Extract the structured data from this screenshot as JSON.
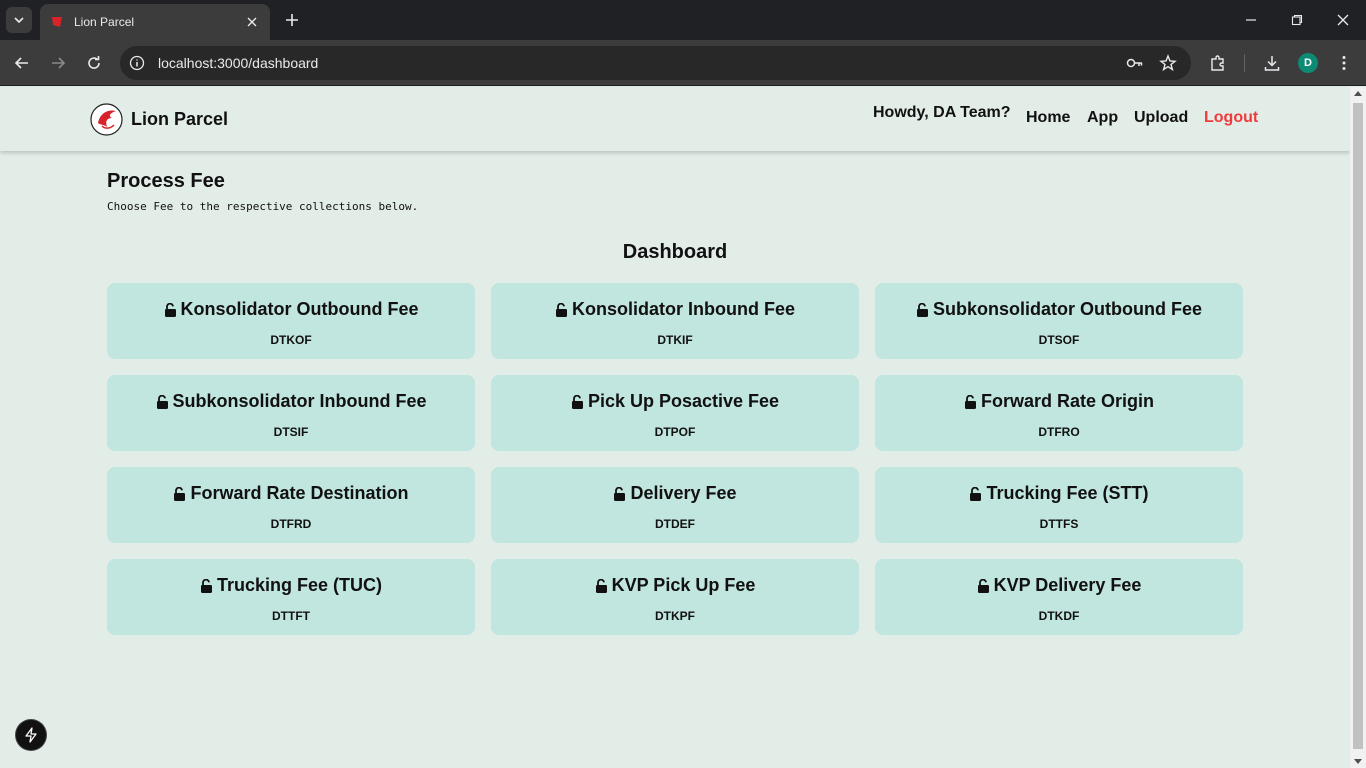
{
  "browser": {
    "tab_title": "Lion Parcel",
    "url": "localhost:3000/dashboard"
  },
  "navbar": {
    "brand": "Lion Parcel",
    "greeting": "Howdy, DA Team?",
    "links": [
      "Home",
      "App",
      "Upload"
    ],
    "logout": "Logout"
  },
  "header": {
    "title": "Process Fee",
    "subtitle": "Choose Fee to the respective collections below."
  },
  "dashboard": {
    "title": "Dashboard",
    "cards": [
      {
        "title": "Konsolidator Outbound Fee",
        "code": "DTKOF"
      },
      {
        "title": "Konsolidator Inbound Fee",
        "code": "DTKIF"
      },
      {
        "title": "Subkonsolidator Outbound Fee",
        "code": "DTSOF"
      },
      {
        "title": "Subkonsolidator Inbound Fee",
        "code": "DTSIF"
      },
      {
        "title": "Pick Up Posactive Fee",
        "code": "DTPOF"
      },
      {
        "title": "Forward Rate Origin",
        "code": "DTFRO"
      },
      {
        "title": "Forward Rate Destination",
        "code": "DTFRD"
      },
      {
        "title": "Delivery Fee",
        "code": "DTDEF"
      },
      {
        "title": "Trucking Fee (STT)",
        "code": "DTTFS"
      },
      {
        "title": "Trucking Fee (TUC)",
        "code": "DTTFT"
      },
      {
        "title": "KVP Pick Up Fee",
        "code": "DTKPF"
      },
      {
        "title": "KVP Delivery Fee",
        "code": "DTKDF"
      }
    ]
  },
  "profile_initial": "D",
  "colors": {
    "page_bg": "#e3ede8",
    "card_bg": "#c1e5df",
    "logout": "#ef3b3b",
    "brand_red": "#d8232a"
  }
}
